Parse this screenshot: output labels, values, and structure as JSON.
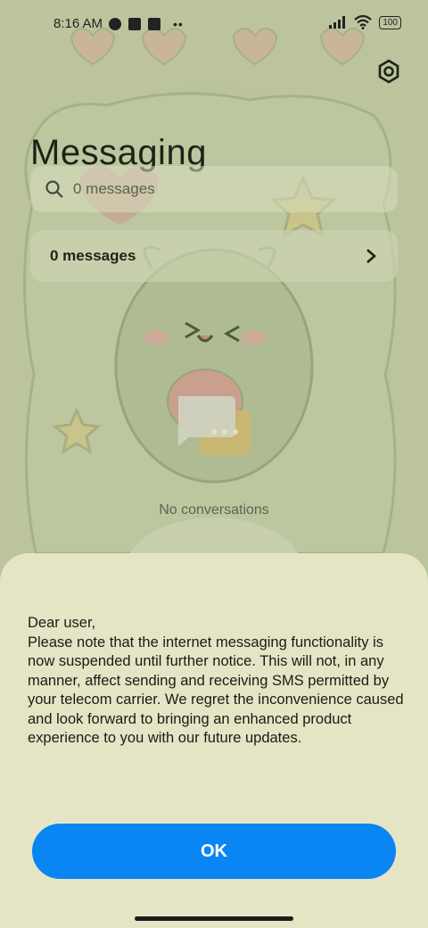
{
  "status_bar": {
    "time": "8:16 AM",
    "battery": "100"
  },
  "header": {
    "title": "Messaging"
  },
  "search": {
    "placeholder": "0 messages"
  },
  "summary": {
    "label": "0 messages"
  },
  "empty_state": {
    "text": "No conversations"
  },
  "dialog": {
    "body": "Dear user,\nPlease note that the internet messaging functionality is now suspended until further notice. This will not, in any manner, affect sending and receiving SMS permitted by your telecom carrier. We regret the inconvenience caused and look forward to bringing an enhanced product experience to you with our future updates.",
    "ok_label": "OK"
  },
  "icons": {
    "settings": "settings-icon",
    "search": "search-icon",
    "chevron": "chevron-right-icon",
    "chat": "chat-bubble-icon",
    "signal": "signal-icon",
    "wifi": "wifi-icon",
    "battery": "battery-icon"
  },
  "colors": {
    "accent": "#0a85f4",
    "sheet": "#e5e5c6",
    "wallpaper": "#b8bf98"
  }
}
